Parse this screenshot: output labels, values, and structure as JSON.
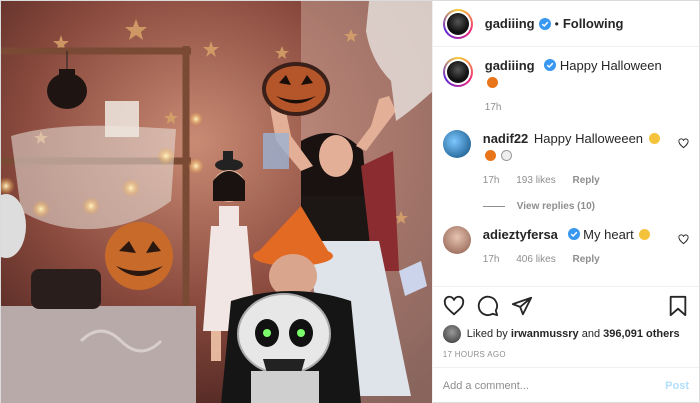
{
  "header": {
    "username": "gadiiing",
    "separator": "•",
    "follow_label": "Following"
  },
  "caption": {
    "username": "gadiiing",
    "text": "Happy Halloween",
    "emoji": "jack-o-lantern",
    "time": "17h"
  },
  "comments": [
    {
      "username": "nadif22",
      "text": "Happy Halloweeen",
      "emoji": [
        "smiling-face-with-heart-eyes",
        "jack-o-lantern",
        "ghost"
      ],
      "time": "17h",
      "likes": "193 likes",
      "reply_label": "Reply",
      "view_replies": "View replies (10)"
    },
    {
      "username": "adieztyfersa",
      "text": "My heart",
      "emoji": [
        "pleading-face"
      ],
      "time": "17h",
      "likes": "406 likes",
      "reply_label": "Reply"
    }
  ],
  "likes": {
    "prefix": "Liked by",
    "user": "irwanmussry",
    "joiner": "and",
    "count": "396,091 others"
  },
  "time_ago": "17 HOURS AGO",
  "add_comment": {
    "placeholder": "Add a comment...",
    "post_label": "Post"
  },
  "colors": {
    "verified": "#3897f0",
    "link_disabled": "#b2dffc",
    "muted": "#8e8e8e",
    "text": "#262626"
  },
  "icons": [
    "heart-icon",
    "comment-icon",
    "share-icon",
    "bookmark-icon",
    "verified-icon"
  ]
}
